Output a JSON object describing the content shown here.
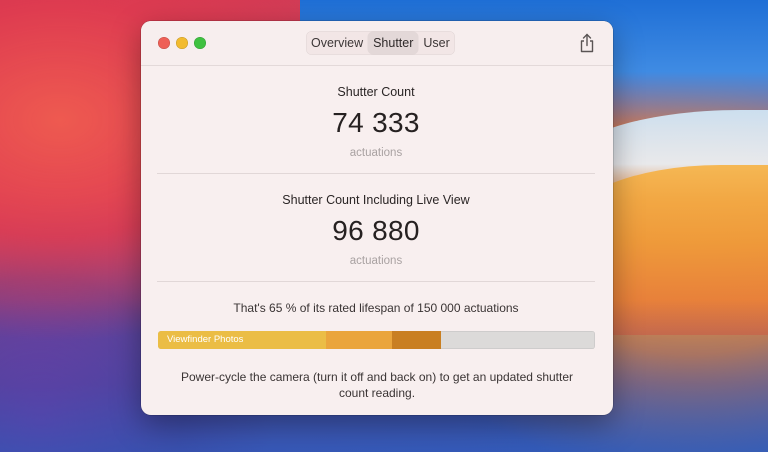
{
  "tabs": [
    {
      "label": "Overview",
      "active": false
    },
    {
      "label": "Shutter",
      "active": true
    },
    {
      "label": "User",
      "active": false
    }
  ],
  "shutter_count": {
    "title": "Shutter Count",
    "value": "74 333",
    "unit": "actuations"
  },
  "shutter_count_live_view": {
    "title": "Shutter Count Including Live View",
    "value": "96 880",
    "unit": "actuations"
  },
  "lifespan_text": "That's 65 % of its rated lifespan of 150 000 actuations",
  "usage_bar": {
    "segments": [
      {
        "label": "Viewfinder Photos",
        "color": "#ebbd45"
      },
      {
        "label": "",
        "color": "#eaa53c"
      },
      {
        "label": "",
        "color": "#c97f22"
      }
    ],
    "remaining_color": "#dcdad9"
  },
  "note": "Power-cycle the camera (turn it off and back on) to get an updated shutter count reading.",
  "icons": {
    "share": "share-icon"
  },
  "colors": {
    "traffic_close": "#ee5f56",
    "traffic_minimize": "#f2bb2f",
    "traffic_maximize": "#3fc140",
    "window_bg": "#f8efef"
  }
}
